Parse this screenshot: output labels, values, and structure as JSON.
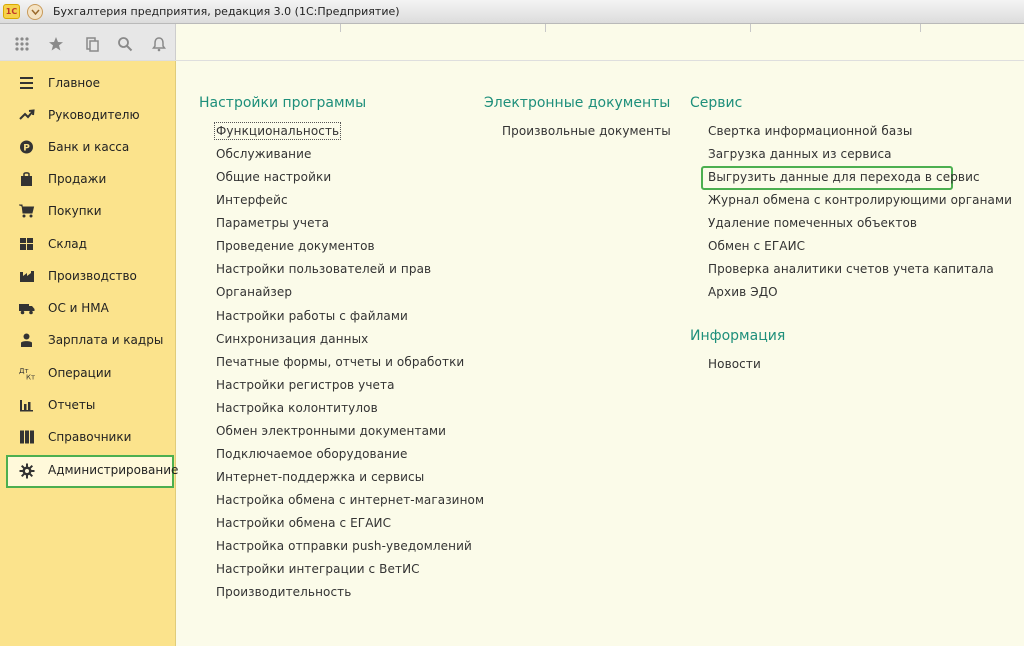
{
  "window": {
    "title": "Бухгалтерия предприятия, редакция 3.0  (1С:Предприятие)",
    "logo_text": "1С"
  },
  "toolbar": {
    "icons": [
      "apps-grid-icon",
      "star-icon",
      "history-icon",
      "search-icon",
      "bell-icon"
    ]
  },
  "sidebar": {
    "items": [
      {
        "label": "Главное",
        "icon": "menu-lines-icon"
      },
      {
        "label": "Руководителю",
        "icon": "trend-icon"
      },
      {
        "label": "Банк и касса",
        "icon": "coin-icon"
      },
      {
        "label": "Продажи",
        "icon": "bag-icon"
      },
      {
        "label": "Покупки",
        "icon": "cart-icon"
      },
      {
        "label": "Склад",
        "icon": "warehouse-icon"
      },
      {
        "label": "Производство",
        "icon": "factory-icon"
      },
      {
        "label": "ОС и НМА",
        "icon": "truck-icon"
      },
      {
        "label": "Зарплата и кадры",
        "icon": "person-icon"
      },
      {
        "label": "Операции",
        "icon": "dt-kt-icon"
      },
      {
        "label": "Отчеты",
        "icon": "bar-chart-icon"
      },
      {
        "label": "Справочники",
        "icon": "books-icon"
      },
      {
        "label": "Администрирование",
        "icon": "gear-icon",
        "active": true
      }
    ]
  },
  "dt_kt_text": {
    "dt": "Дт",
    "kt": "Кт"
  },
  "sections": {
    "settings": {
      "title": "Настройки программы",
      "links": [
        "Функциональность",
        "Обслуживание",
        "Общие настройки",
        "Интерфейс",
        "Параметры учета",
        "Проведение документов",
        "Настройки пользователей и прав",
        "Органайзер",
        "Настройки работы с файлами",
        "Синхронизация данных",
        "Печатные формы, отчеты и обработки",
        "Настройки регистров учета",
        "Настройка колонтитулов",
        "Обмен электронными документами",
        "Подключаемое оборудование",
        "Интернет-поддержка и сервисы",
        "Настройка обмена с интернет-магазином",
        "Настройки обмена с ЕГАИС",
        "Настройка отправки push-уведомлений",
        "Настройки интеграции с ВетИС",
        "Производительность"
      ]
    },
    "edocs": {
      "title": "Электронные документы",
      "links": [
        "Произвольные документы"
      ]
    },
    "service": {
      "title": "Сервис",
      "links": [
        "Свертка информационной базы",
        "Загрузка данных из сервиса",
        "Выгрузить данные для перехода в сервис",
        "Журнал обмена с контролирующими органами",
        "Удаление помеченных объектов",
        "Обмен с ЕГАИС",
        "Проверка аналитики счетов учета капитала",
        "Архив ЭДО"
      ]
    },
    "info": {
      "title": "Информация",
      "links": [
        "Новости"
      ]
    }
  },
  "colors": {
    "section_title": "#1e8f7b",
    "sidebar_bg": "#fbe38c",
    "content_bg": "#fbfbe9",
    "highlight": "#4caf50"
  }
}
